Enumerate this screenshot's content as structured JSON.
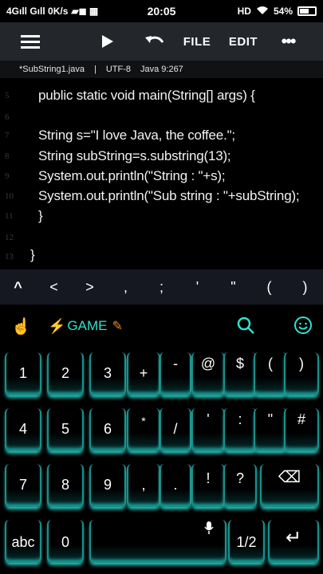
{
  "status": {
    "left": "4Gıll Gıll 0K/s",
    "media_glyph": "▰◼ ▦",
    "time": "20:05",
    "hd": "HD",
    "battery": "54%"
  },
  "toolbar": {
    "file_label": "FILE",
    "edit_label": "EDIT"
  },
  "fileinfo": {
    "filename": "*SubString1.java",
    "sep": "|",
    "encoding": "UTF-8",
    "lang_pos": "Java  9:267"
  },
  "editor": {
    "lines": [
      {
        "num": "5",
        "text": "public static void main(String[] args) {"
      },
      {
        "num": "6",
        "text": ""
      },
      {
        "num": "7",
        "text": "String s=\"I love Java, the coffee.\";"
      },
      {
        "num": "8",
        "text": "String subString=s.substring(13);"
      },
      {
        "num": "9",
        "text": "System.out.println(\"String : \"+s);"
      },
      {
        "num": "10",
        "text": "System.out.println(\"Sub string : \"+subString);"
      },
      {
        "num": "11",
        "text": "}"
      },
      {
        "num": "12",
        "text": ""
      },
      {
        "num": "13",
        "text": "}"
      }
    ]
  },
  "symbols": [
    "^",
    "<",
    ">",
    ",",
    ";",
    "'",
    "\"",
    "(",
    ")"
  ],
  "keyboard": {
    "game_label": "GAME",
    "rows": [
      [
        {
          "m": "1",
          "s": ""
        },
        {
          "m": "2",
          "s": ""
        },
        {
          "m": "3",
          "s": ""
        },
        {
          "m": "+",
          "s": ""
        },
        {
          "m": "-",
          "s": ""
        },
        {
          "m": "@",
          "s": ""
        },
        {
          "m": "$",
          "s": ""
        },
        {
          "m": "(",
          "s": ""
        },
        {
          "m": ")",
          "s": ""
        }
      ],
      [
        {
          "m": "4",
          "s": ""
        },
        {
          "m": "5",
          "s": ""
        },
        {
          "m": "6",
          "s": ""
        },
        {
          "m": "*",
          "s": ""
        },
        {
          "m": "/",
          "s": ""
        },
        {
          "m": "'",
          "s": ""
        },
        {
          "m": ":",
          "s": ""
        },
        {
          "m": "\"",
          "s": ""
        },
        {
          "m": "#",
          "s": ""
        }
      ],
      [
        {
          "m": "7",
          "s": ""
        },
        {
          "m": "8",
          "s": ""
        },
        {
          "m": "9",
          "s": ""
        },
        {
          "m": ",",
          "s": ""
        },
        {
          "m": ".",
          "s": ""
        },
        {
          "m": "!",
          "s": ""
        },
        {
          "m": "?",
          "s": ""
        },
        {
          "m": "⌫",
          "s": ""
        }
      ],
      [
        {
          "m": "abc",
          "s": ""
        },
        {
          "m": "0",
          "s": ""
        },
        {
          "m": "",
          "s": ""
        },
        {
          "m": "1/2",
          "s": ""
        },
        {
          "m": "↵",
          "s": ""
        }
      ]
    ]
  },
  "colors": {
    "accent": "#2fe0d0",
    "toolbar_bg": "#23262b",
    "symbar_bg": "#151821"
  }
}
